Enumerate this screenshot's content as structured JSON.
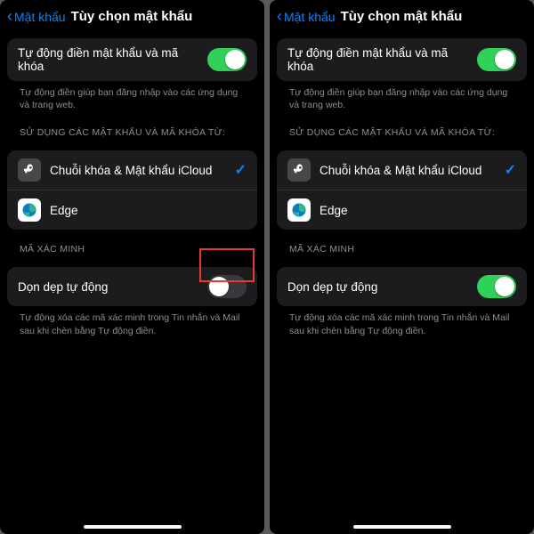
{
  "nav": {
    "back_label": "Mật khẩu",
    "title": "Tùy chọn mật khẩu"
  },
  "autofill": {
    "label": "Tự động điền mật khẩu và mã khóa",
    "footer": "Tự động điền giúp bạn đăng nhập vào các ứng dụng và trang web."
  },
  "sources": {
    "header": "SỬ DỤNG CÁC MẬT KHẨU VÀ MÃ KHÓA TỪ:",
    "keychain": "Chuỗi khóa & Mật khẩu iCloud",
    "edge": "Edge"
  },
  "verify": {
    "header": "MÃ XÁC MINH",
    "cleanup": "Dọn dẹp tự động",
    "footer": "Tự động xóa các mã xác minh trong Tin nhắn và Mail sau khi chèn bằng Tự động điền."
  }
}
